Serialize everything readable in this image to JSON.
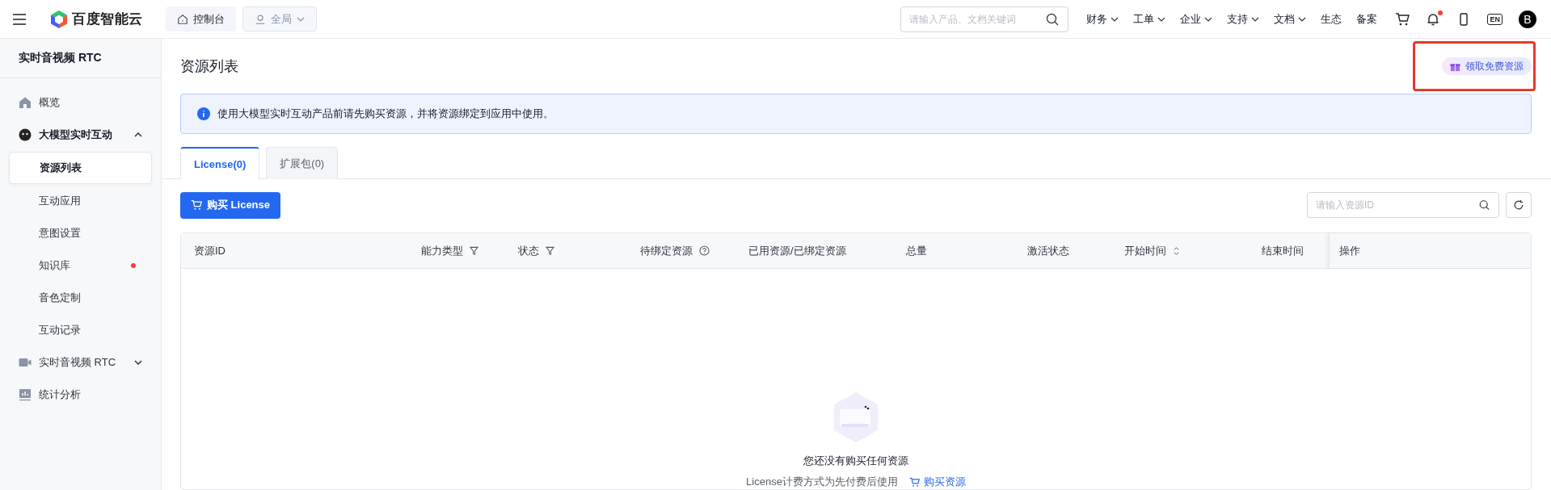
{
  "topbar": {
    "brand": "百度智能云",
    "console_button": "控制台",
    "region_select": "全局",
    "search": {
      "placeholder": "请输入产品、文档关键词"
    },
    "nav": [
      {
        "label": "财务",
        "dropdown": true
      },
      {
        "label": "工单",
        "dropdown": true
      },
      {
        "label": "企业",
        "dropdown": true
      },
      {
        "label": "支持",
        "dropdown": true
      },
      {
        "label": "文档",
        "dropdown": true
      },
      {
        "label": "生态",
        "dropdown": false
      },
      {
        "label": "备案",
        "dropdown": false
      }
    ],
    "notification_dot": true,
    "language": "EN",
    "avatar": "B"
  },
  "sidebar": {
    "title": "实时音视频 RTC",
    "items": [
      {
        "label": "概览",
        "kind": "link"
      },
      {
        "label": "大模型实时互动",
        "kind": "group",
        "expanded": true,
        "children": [
          {
            "label": "资源列表",
            "selected": true,
            "badge": false
          },
          {
            "label": "互动应用",
            "selected": false,
            "badge": false
          },
          {
            "label": "意图设置",
            "selected": false,
            "badge": false
          },
          {
            "label": "知识库",
            "selected": false,
            "badge": true
          },
          {
            "label": "音色定制",
            "selected": false,
            "badge": false
          },
          {
            "label": "互动记录",
            "selected": false,
            "badge": false
          }
        ]
      },
      {
        "label": "实时音视频 RTC",
        "kind": "group",
        "expanded": false
      },
      {
        "label": "统计分析",
        "kind": "link"
      }
    ]
  },
  "page": {
    "title": "资源列表",
    "free_resource_button": "领取免费资源",
    "highlighted": true,
    "notice": "使用大模型实时互动产品前请先购买资源，并将资源绑定到应用中使用。",
    "tabs": [
      {
        "label": "License(0)",
        "selected": true
      },
      {
        "label": "扩展包(0)",
        "selected": false
      }
    ],
    "buy_button": "购买 License",
    "id_search": {
      "placeholder": "请输入资源ID"
    },
    "table": {
      "columns": [
        {
          "label": "资源ID",
          "kind": "plain"
        },
        {
          "label": "能力类型",
          "kind": "filter"
        },
        {
          "label": "状态",
          "kind": "filter"
        },
        {
          "label": "待绑定资源",
          "kind": "help"
        },
        {
          "label": "已用资源/已绑定资源",
          "kind": "plain"
        },
        {
          "label": "总量",
          "kind": "plain"
        },
        {
          "label": "激活状态",
          "kind": "plain"
        },
        {
          "label": "开始时间",
          "kind": "sort"
        },
        {
          "label": "结束时间",
          "kind": "plain"
        },
        {
          "label": "操作",
          "kind": "fixed"
        }
      ]
    },
    "empty": {
      "title": "您还没有购买任何资源",
      "hint": "License计费方式为先付费后使用",
      "link": "购买资源"
    }
  }
}
